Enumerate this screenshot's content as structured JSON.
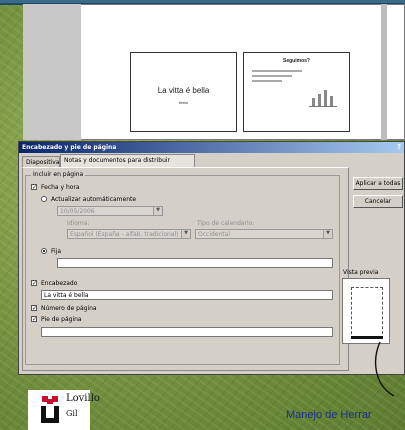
{
  "slides": {
    "slide1": {
      "title": "La vitta é bella",
      "subtitle": "texto"
    },
    "slide2": {
      "title": "Seguimos?"
    }
  },
  "dialog": {
    "title": "Encabezado y pie de página",
    "help": "?",
    "tabs": [
      "Diapositiva",
      "Notas y documentos para distribuir"
    ],
    "group_label": "Incluir en página",
    "fecha_hora": {
      "label": "Fecha y hora",
      "checked": true
    },
    "actualizar": {
      "label": "Actualizar automáticamente",
      "selected": false
    },
    "date_value": "10/05/2006",
    "idioma": {
      "label": "Idioma:",
      "value": "Español (España - alfab. tradicional)"
    },
    "calendario": {
      "label": "Tipo de calendario:",
      "value": "Occidental"
    },
    "fija": {
      "label": "Fija",
      "selected": true,
      "value": ""
    },
    "encabezado": {
      "label": "Encabezado",
      "checked": true,
      "value": "La vitta é bella"
    },
    "numero_pagina": {
      "label": "Número de página",
      "checked": true
    },
    "pie_pagina": {
      "label": "Pie de página",
      "checked": true,
      "value": ""
    },
    "buttons": {
      "apply_all": "Aplicar a todas",
      "cancel": "Cancelar"
    },
    "preview_label": "Vista previa"
  },
  "footer": {
    "logo_line1": "Lovillo",
    "logo_line2": "Gil",
    "caption": "Manejo de Herrar",
    "logo_color": "#c8102e"
  }
}
